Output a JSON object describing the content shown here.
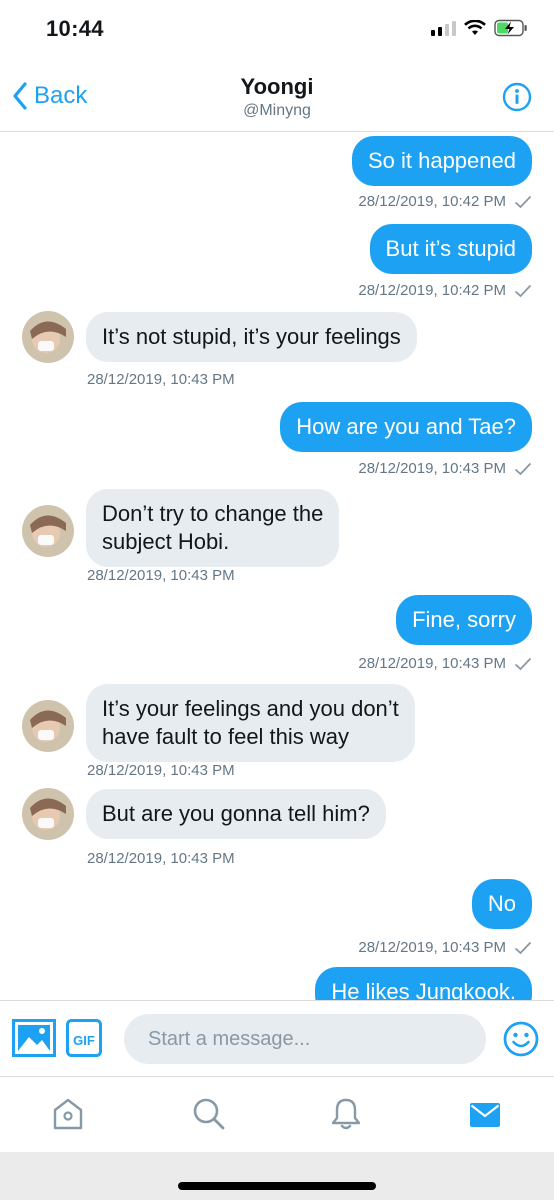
{
  "status_bar": {
    "time": "10:44",
    "icons": [
      "cellular-signal-icon",
      "wifi-icon",
      "battery-charging-icon"
    ]
  },
  "header": {
    "back_label": "Back",
    "name": "Yoongi",
    "handle": "@Minyng",
    "info_icon": "info-icon"
  },
  "messages": [
    {
      "direction": "outgoing",
      "text": "So it happened",
      "timestamp": "28/12/2019, 10:42 PM",
      "read_check": true
    },
    {
      "direction": "outgoing",
      "text": "But it’s stupid",
      "timestamp": "28/12/2019, 10:42 PM",
      "read_check": true
    },
    {
      "direction": "incoming",
      "text": "It’s not stupid, it’s your feelings",
      "timestamp": "28/12/2019, 10:43 PM"
    },
    {
      "direction": "outgoing",
      "text": "How are you and Tae?",
      "timestamp": "28/12/2019, 10:43 PM",
      "read_check": true
    },
    {
      "direction": "incoming",
      "lines": [
        "Don’t try to change the",
        "subject Hobi."
      ],
      "timestamp": "28/12/2019, 10:43 PM"
    },
    {
      "direction": "outgoing",
      "text": "Fine, sorry",
      "timestamp": "28/12/2019, 10:43 PM",
      "read_check": true
    },
    {
      "direction": "incoming",
      "lines": [
        "It’s your feelings and you don’t",
        "have fault to feel this way"
      ],
      "timestamp": "28/12/2019, 10:43 PM"
    },
    {
      "direction": "incoming",
      "text": "But are you gonna tell him?",
      "timestamp": "28/12/2019, 10:43 PM"
    },
    {
      "direction": "outgoing",
      "text": "No",
      "timestamp": "28/12/2019, 10:43 PM",
      "read_check": true
    },
    {
      "direction": "outgoing",
      "text": "He likes Jungkook.",
      "partially_visible": true
    }
  ],
  "composer": {
    "placeholder": "Start a message...",
    "gif_label": "GIF",
    "icons": [
      "image-icon",
      "gif-icon",
      "emoji-icon"
    ]
  },
  "tab_bar": {
    "tabs": [
      "home",
      "search",
      "notifications",
      "messages"
    ],
    "active": "messages"
  },
  "colors": {
    "accent": "#1da1f2",
    "incoming_bubble": "#e6ecf0",
    "timestamp_text": "#657786",
    "divider": "#d9dde1",
    "inactive_icon": "#8899a6"
  }
}
